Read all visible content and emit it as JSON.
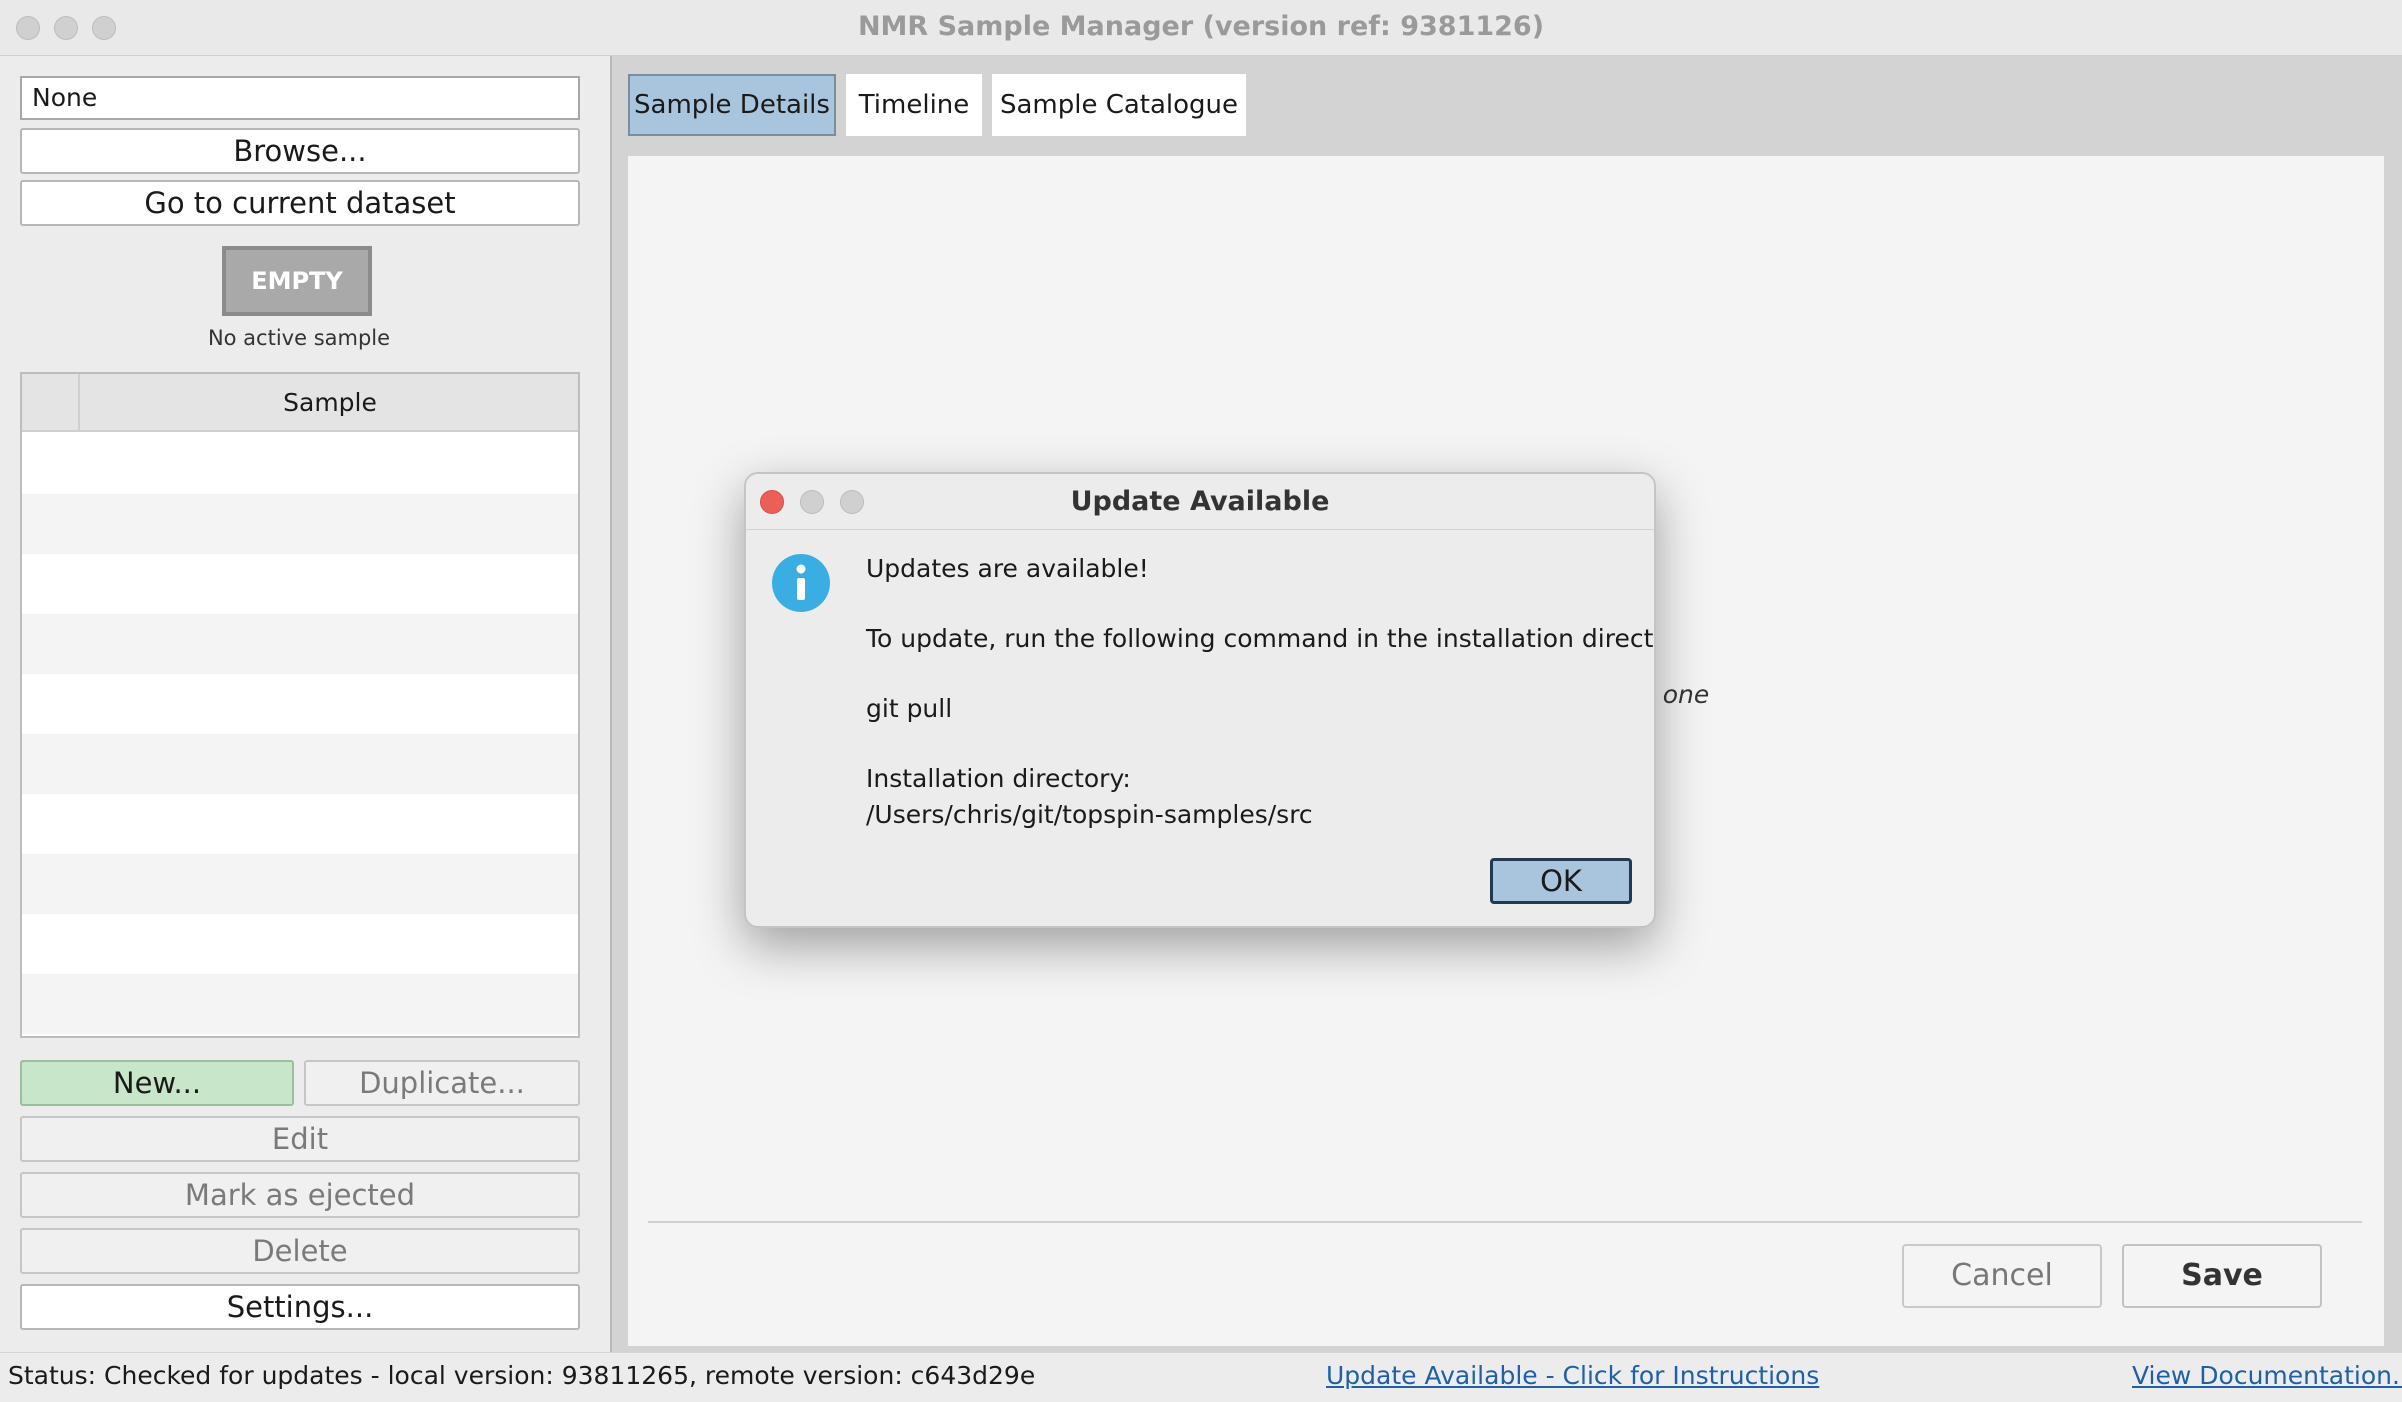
{
  "window": {
    "title": "NMR Sample Manager (version ref: 9381126)"
  },
  "left": {
    "dataset_field": "None",
    "browse_label": "Browse...",
    "goto_label": "Go to current dataset",
    "status_badge": "EMPTY",
    "no_active": "No active sample",
    "table": {
      "column_header": "Sample"
    },
    "buttons": {
      "new": "New...",
      "duplicate": "Duplicate...",
      "edit": "Edit",
      "eject": "Mark as ejected",
      "delete": "Delete",
      "settings": "Settings..."
    }
  },
  "tabs": [
    "Sample Details",
    "Timeline",
    "Sample Catalogue"
  ],
  "main": {
    "hint_fragment": "v one",
    "cancel_label": "Cancel",
    "save_label": "Save"
  },
  "dialog": {
    "title": "Update Available",
    "icon": "info-icon",
    "line1": "Updates are available!",
    "line2": "To update, run the following command in the installation directory:",
    "command": "git pull",
    "dir_label": "Installation directory:",
    "dir_path": "/Users/chris/git/topspin-samples/src",
    "ok_label": "OK"
  },
  "status": {
    "text": "Status: Checked for updates - local version: 93811265, remote version: c643d29e",
    "update_link": "Update Available - Click for Instructions",
    "docs_link": "View Documentation..."
  },
  "colors": {
    "accent_blue": "#a9c5dd",
    "new_button_green": "#c8e6c9",
    "info_icon": "#3aaee3",
    "link": "#1f5fa8"
  }
}
